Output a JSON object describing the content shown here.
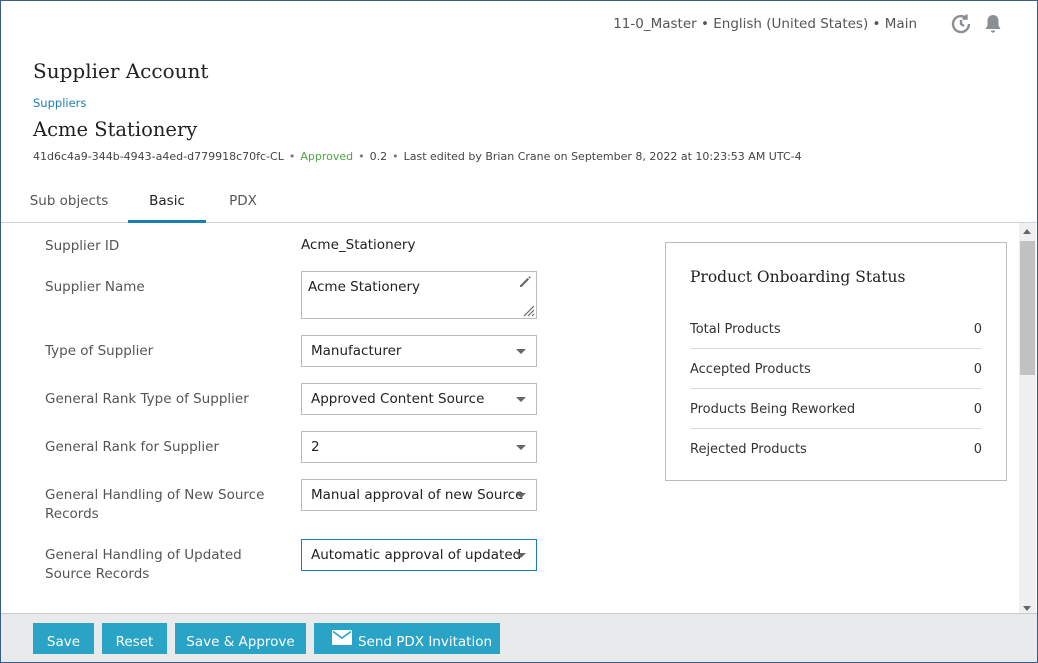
{
  "header": {
    "context": "11-0_Master • English (United States) • Main",
    "history_icon": "history-icon",
    "bell_icon": "bell-icon"
  },
  "page": {
    "title": "Supplier Account",
    "breadcrumb": "Suppliers",
    "object_name": "Acme Stationery",
    "object_id": "41d6c4a9-344b-4943-a4ed-d779918c70fc-CL",
    "status": "Approved",
    "version": "0.2",
    "last_edited": "Last edited by Brian Crane on September 8, 2022 at 10:23:53 AM UTC-4"
  },
  "tabs": [
    {
      "label": "Sub objects",
      "active": false
    },
    {
      "label": "Basic",
      "active": true
    },
    {
      "label": "PDX",
      "active": false
    }
  ],
  "form": {
    "supplier_id": {
      "label": "Supplier ID",
      "value": "Acme_Stationery"
    },
    "supplier_name": {
      "label": "Supplier Name",
      "value": "Acme Stationery"
    },
    "type_of_supplier": {
      "label": "Type of Supplier",
      "value": "Manufacturer"
    },
    "rank_type": {
      "label": "General Rank Type of Supplier",
      "value": "Approved Content Source"
    },
    "rank": {
      "label": "General Rank for Supplier",
      "value": "2"
    },
    "new_source": {
      "label": "General Handling of New Source Records",
      "value": "Manual approval of new Source"
    },
    "updated_source": {
      "label": "General Handling of Updated Source Records",
      "value": "Automatic approval of updated"
    }
  },
  "status_card": {
    "title": "Product Onboarding Status",
    "rows": [
      {
        "label": "Total Products",
        "value": "0"
      },
      {
        "label": "Accepted Products",
        "value": "0"
      },
      {
        "label": "Products Being Reworked",
        "value": "0"
      },
      {
        "label": "Rejected Products",
        "value": "0"
      }
    ]
  },
  "footer": {
    "save": "Save",
    "reset": "Reset",
    "save_approve": "Save & Approve",
    "send_pdx": "Send PDX Invitation"
  },
  "colors": {
    "accent": "#1a7fb3",
    "button": "#29a3c6",
    "approved": "#4aa544"
  }
}
